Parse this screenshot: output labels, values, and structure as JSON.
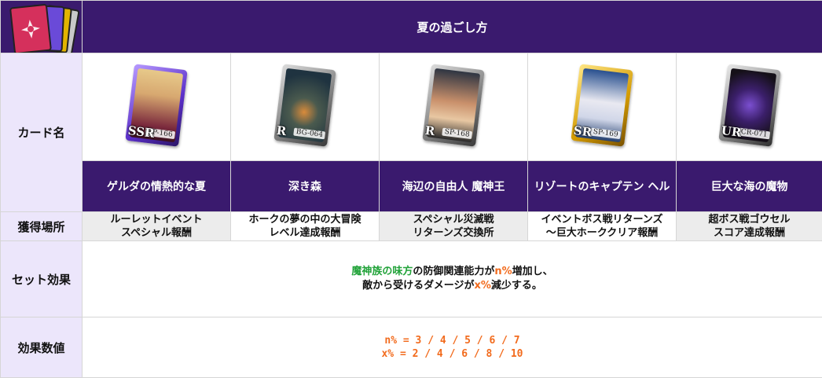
{
  "header": {
    "title": "夏の過ごし方",
    "icon": "card-stack-icon"
  },
  "row_labels": {
    "card_name": "カード名",
    "location": "獲得場所",
    "set_effect": "セット効果",
    "effect_values": "効果数値"
  },
  "cards": [
    {
      "rank": "SSR",
      "code": "SP-166",
      "name": "ゲルダの情熱的な夏",
      "location_line1": "ルーレットイベント",
      "location_line2": "スペシャル報酬"
    },
    {
      "rank": "R",
      "code": "BG-064",
      "name": "深き森",
      "location_line1": "ホークの夢の中の大冒険",
      "location_line2": "レベル達成報酬"
    },
    {
      "rank": "R",
      "code": "SP-168",
      "name": "海辺の自由人 魔神王",
      "location_line1": "スペシャル災滅戦",
      "location_line2": "リターンズ交換所"
    },
    {
      "rank": "SR",
      "code": "SP-169",
      "name": "リゾートのキャプテン ヘル",
      "location_line1": "イベントボス戦リターンズ",
      "location_line2": "～巨大ホーククリア報酬"
    },
    {
      "rank": "UR",
      "code": "CR-071",
      "name": "巨大な海の魔物",
      "location_line1": "超ボス戦ゴウセル",
      "location_line2": "スコア達成報酬"
    }
  ],
  "set_effect": {
    "part1": "魔神族の味方",
    "part2": "の防御関連能力が",
    "part3": "n%",
    "part4": "増加し、",
    "part5": "敵から受けるダメージが",
    "part6": "x%",
    "part7": "減少する。"
  },
  "effect_values": {
    "line1": "n% = 3 / 4 / 5 / 6 / 7",
    "line2": "x% = 2 / 4 / 6 / 8 / 10"
  },
  "colors": {
    "header_bg": "#3a1a6e",
    "rowhead_bg": "#ece6fb",
    "highlight_green": "#22a33a",
    "highlight_orange": "#f26b1d"
  }
}
